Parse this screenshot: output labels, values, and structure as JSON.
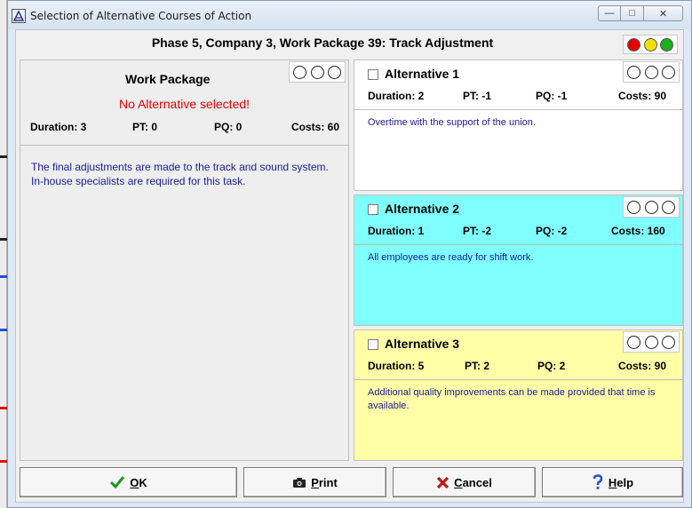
{
  "window": {
    "title": "Selection of Alternative Courses of Action",
    "min_symbol": "—",
    "max_symbol": "□",
    "close_symbol": "✕"
  },
  "header": {
    "title": "Phase 5, Company 3, Work Package 39: Track Adjustment",
    "status_lights": [
      "#e60000",
      "#f0e000",
      "#19b019"
    ]
  },
  "work_package": {
    "heading": "Work Package",
    "status": "No Alternative selected!",
    "duration": "Duration: 3",
    "pt": "PT: 0",
    "pq": "PQ: 0",
    "costs": "Costs: 60",
    "description": "The final adjustments are made to the track and sound system. In-house specialists are required for this task."
  },
  "alternatives": [
    {
      "title": "Alternative 1",
      "duration": "Duration: 2",
      "pt": "PT: -1",
      "pq": "PQ: -1",
      "costs": "Costs: 90",
      "description": "Overtime with the support of the union.",
      "color": "#ffffff"
    },
    {
      "title": "Alternative 2",
      "duration": "Duration: 1",
      "pt": "PT: -2",
      "pq": "PQ: -2",
      "costs": "Costs: 160",
      "description": "All employees are ready for shift work.",
      "color": "#80ffff"
    },
    {
      "title": "Alternative 3",
      "duration": "Duration: 5",
      "pt": "PT: 2",
      "pq": "PQ: 2",
      "costs": "Costs: 90",
      "description": "Additional quality improvements can be made provided that time is available.",
      "color": "#ffffa8"
    }
  ],
  "buttons": {
    "ok_first": "O",
    "ok_rest": "K",
    "print_first": "P",
    "print_rest": "rint",
    "cancel_first": "C",
    "cancel_rest": "ancel",
    "help_first": "H",
    "help_rest": "elp",
    "icons": {
      "ok": "checkmark-icon",
      "print": "camera-icon",
      "cancel": "x-icon",
      "help": "question-icon"
    }
  }
}
